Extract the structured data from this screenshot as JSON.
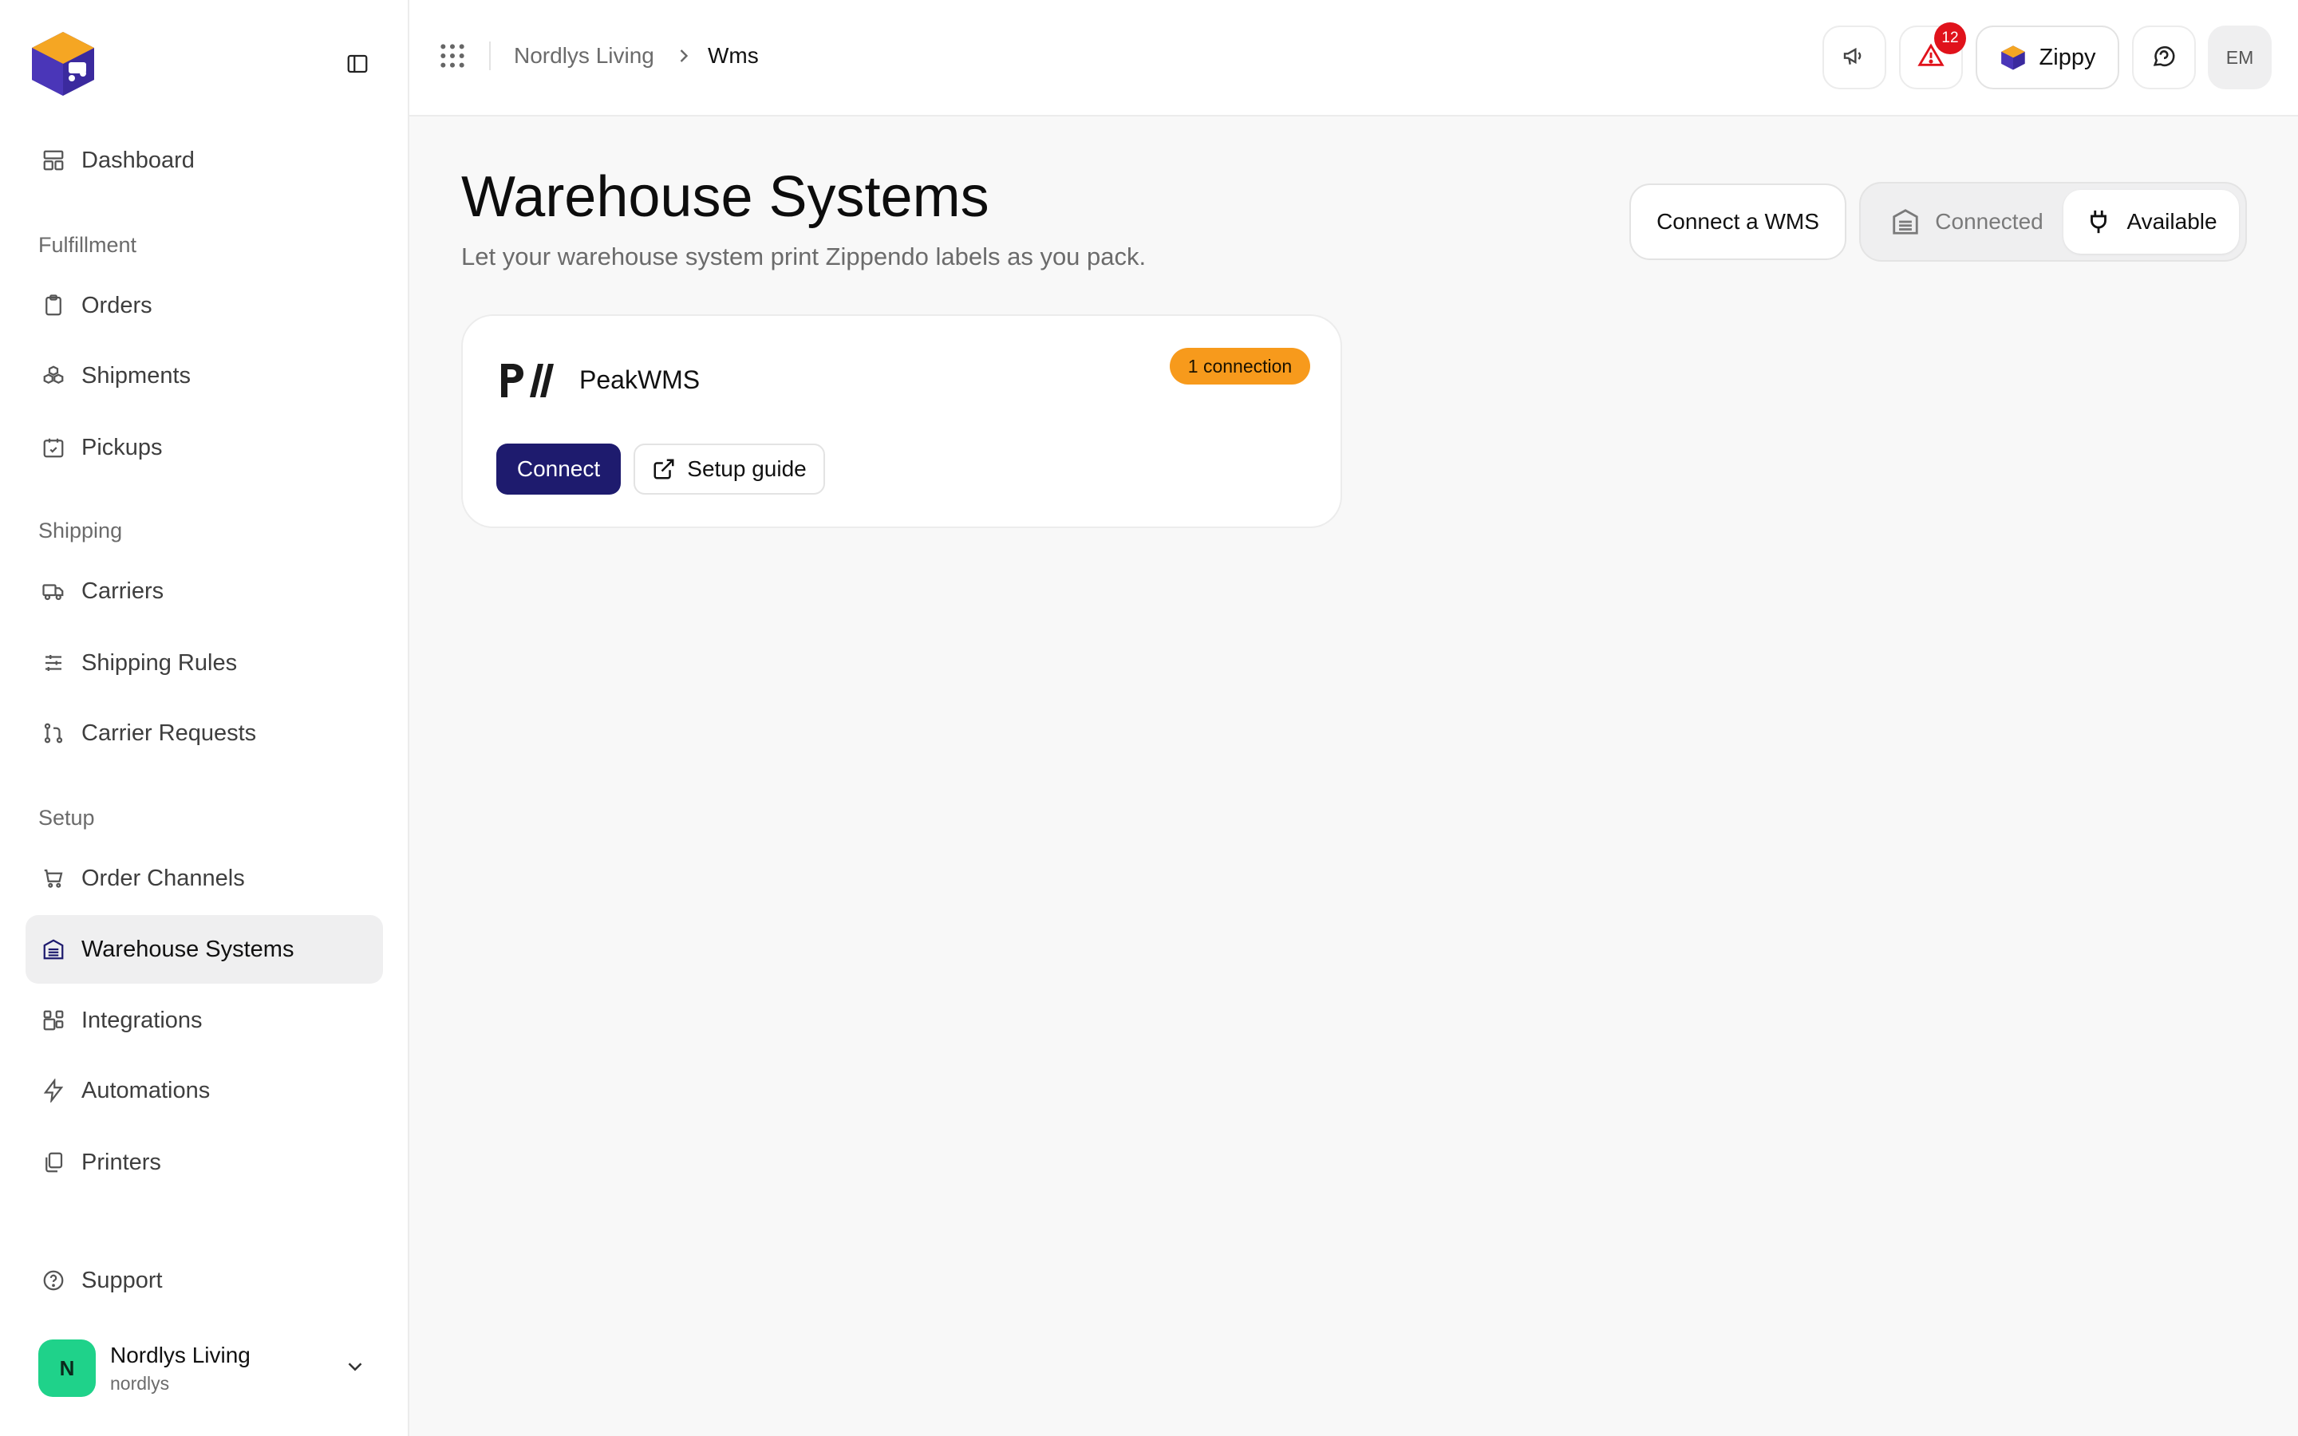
{
  "sidebar": {
    "dashboard": "Dashboard",
    "sections": {
      "fulfillment": "Fulfillment",
      "shipping": "Shipping",
      "setup": "Setup"
    },
    "items": {
      "orders": "Orders",
      "shipments": "Shipments",
      "pickups": "Pickups",
      "carriers": "Carriers",
      "shipping_rules": "Shipping Rules",
      "carrier_requests": "Carrier Requests",
      "order_channels": "Order Channels",
      "warehouse_systems": "Warehouse Systems",
      "integrations": "Integrations",
      "automations": "Automations",
      "printers": "Printers"
    },
    "support": "Support",
    "org": {
      "initial": "N",
      "name": "Nordlys Living",
      "slug": "nordlys"
    }
  },
  "topbar": {
    "breadcrumb": [
      "Nordlys Living",
      "Wms"
    ],
    "alert_count": "12",
    "assistant_label": "Zippy",
    "user_initials": "EM"
  },
  "main": {
    "title": "Warehouse Systems",
    "subtitle": "Let your warehouse system print Zippendo labels as you pack.",
    "connect_wms_label": "Connect a WMS",
    "toggle": {
      "connected": "Connected",
      "available": "Available",
      "selected": "Available"
    },
    "cards": [
      {
        "logo_text": "P//",
        "name": "PeakWMS",
        "badge": "1 connection",
        "connect_label": "Connect",
        "guide_label": "Setup guide"
      }
    ]
  },
  "colors": {
    "brand_navy": "#1e1b6e",
    "badge_orange": "#f79a1c",
    "alert_red": "#e0121b",
    "org_green": "#1fd28a",
    "logo_orange": "#f5a623",
    "logo_indigo": "#3b2a9e"
  }
}
